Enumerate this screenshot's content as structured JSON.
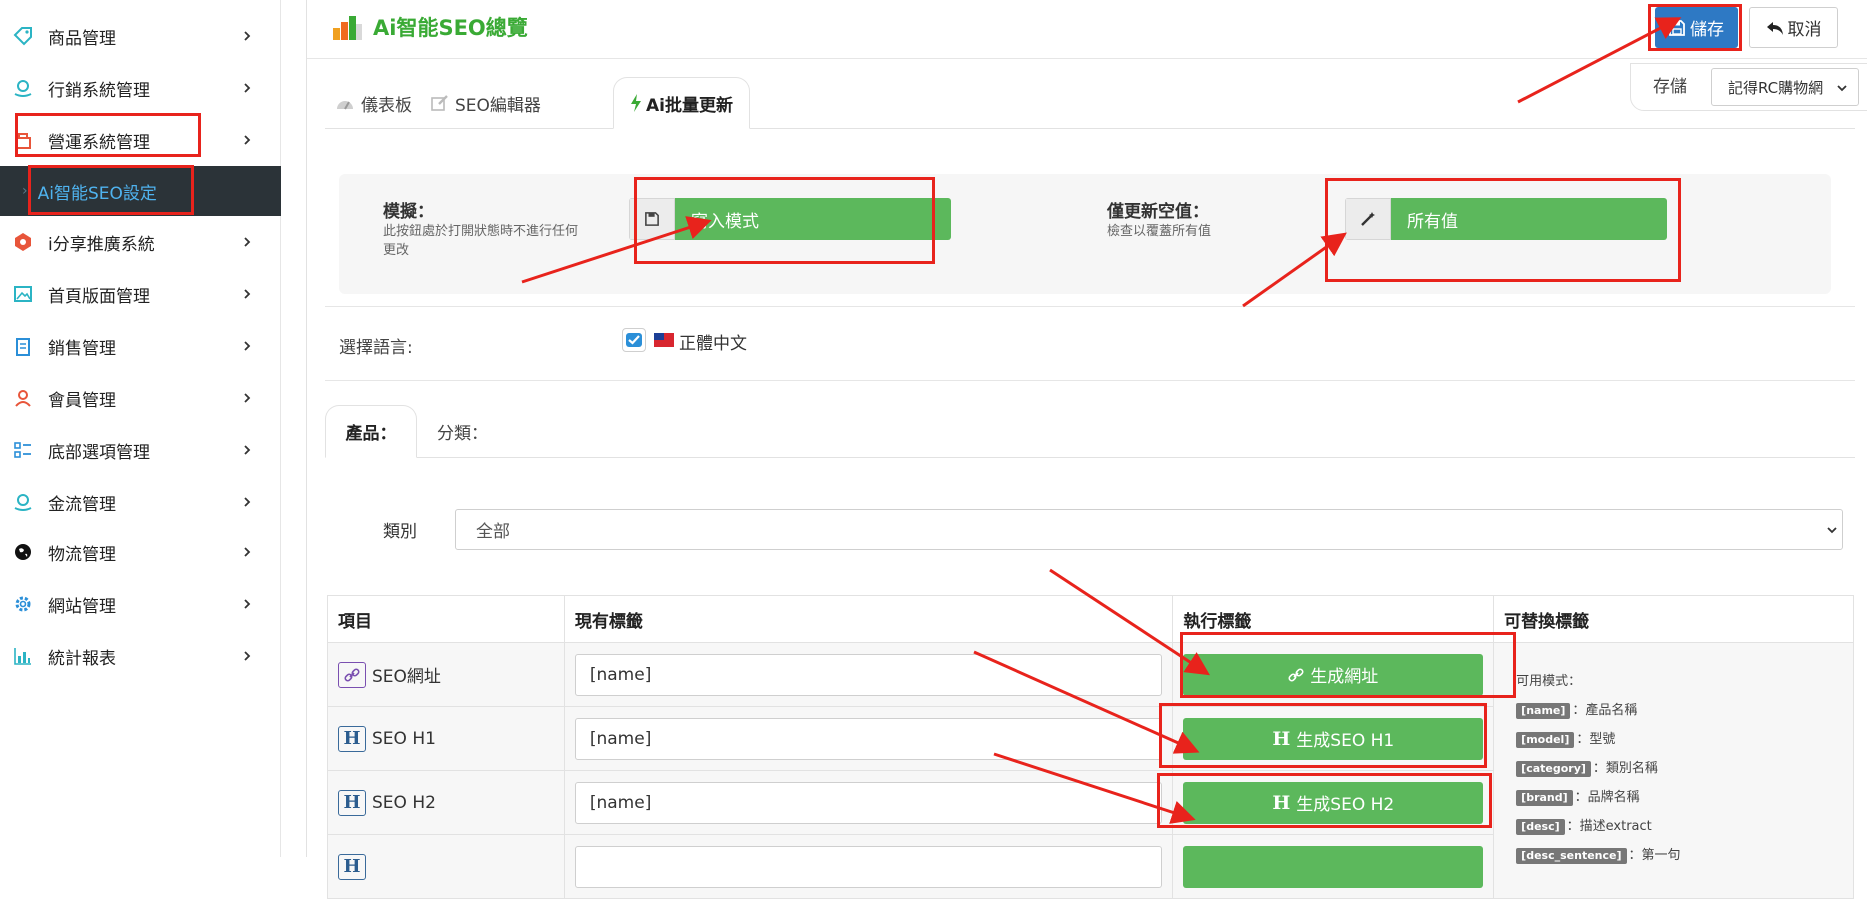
{
  "sidebar": {
    "items": [
      {
        "label": "商品管理",
        "icon": "tag-icon"
      },
      {
        "label": "行銷系統管理",
        "icon": "marketing-icon"
      },
      {
        "label": "營運系統管理",
        "icon": "operations-icon"
      },
      {
        "label": "i分享推廣系統",
        "icon": "share-icon"
      },
      {
        "label": "首頁版面管理",
        "icon": "image-icon"
      },
      {
        "label": "銷售管理",
        "icon": "clipboard-icon"
      },
      {
        "label": "會員管理",
        "icon": "user-icon"
      },
      {
        "label": "底部選項管理",
        "icon": "list-icon"
      },
      {
        "label": "金流管理",
        "icon": "money-icon"
      },
      {
        "label": "物流管理",
        "icon": "globe-icon"
      },
      {
        "label": "網站管理",
        "icon": "gear-icon"
      },
      {
        "label": "統計報表",
        "icon": "bar-chart-icon"
      }
    ],
    "active_sub": "Ai智能SEO設定"
  },
  "header": {
    "title": "Ai智能SEO總覽",
    "save_label": "儲存",
    "cancel_label": "取消",
    "store_label": "存儲",
    "store_value": "記得RC購物網"
  },
  "tabs": [
    "儀表板",
    "SEO編輯器",
    "Ai批量更新"
  ],
  "options": {
    "simulate_title": "模擬：",
    "simulate_desc": "此按鈕處於打開狀態時不進行任何更改",
    "simulate_button": "寫入模式",
    "update_empty_title": "僅更新空值：",
    "update_empty_desc": "檢查以覆蓋所有值",
    "update_empty_button": "所有值"
  },
  "language": {
    "label": "選擇語言:",
    "value": "正體中文",
    "checked": true
  },
  "subtabs": [
    "產品：",
    "分類："
  ],
  "category": {
    "label": "類別",
    "value": "全部"
  },
  "table": {
    "headers": [
      "項目",
      "現有標籤",
      "執行標籤",
      "可替換標籤"
    ],
    "rows": [
      {
        "item": "SEO網址",
        "value": "[name]",
        "action": "生成網址"
      },
      {
        "item": "SEO H1",
        "value": "[name]",
        "action": "生成SEO H1"
      },
      {
        "item": "SEO H2",
        "value": "[name]",
        "action": "生成SEO H2"
      }
    ],
    "help_title": "可用模式：",
    "help_tags": [
      {
        "tag": "[name]",
        "desc": "：產品名稱"
      },
      {
        "tag": "[model]",
        "desc": "：型號"
      },
      {
        "tag": "[category]",
        "desc": "：類別名稱"
      },
      {
        "tag": "[brand]",
        "desc": "：品牌名稱"
      },
      {
        "tag": "[desc]",
        "desc": "：描述extract"
      },
      {
        "tag": "[desc_sentence]",
        "desc": "：第一句"
      }
    ]
  },
  "colors": {
    "accent_green": "#5cb85c",
    "title_green": "#3aaa35",
    "save_blue": "#2e79c4",
    "annotation_red": "#e8231c",
    "sidebar_active_bg": "#2b3338",
    "sidebar_active_text": "#4fb3ef"
  }
}
